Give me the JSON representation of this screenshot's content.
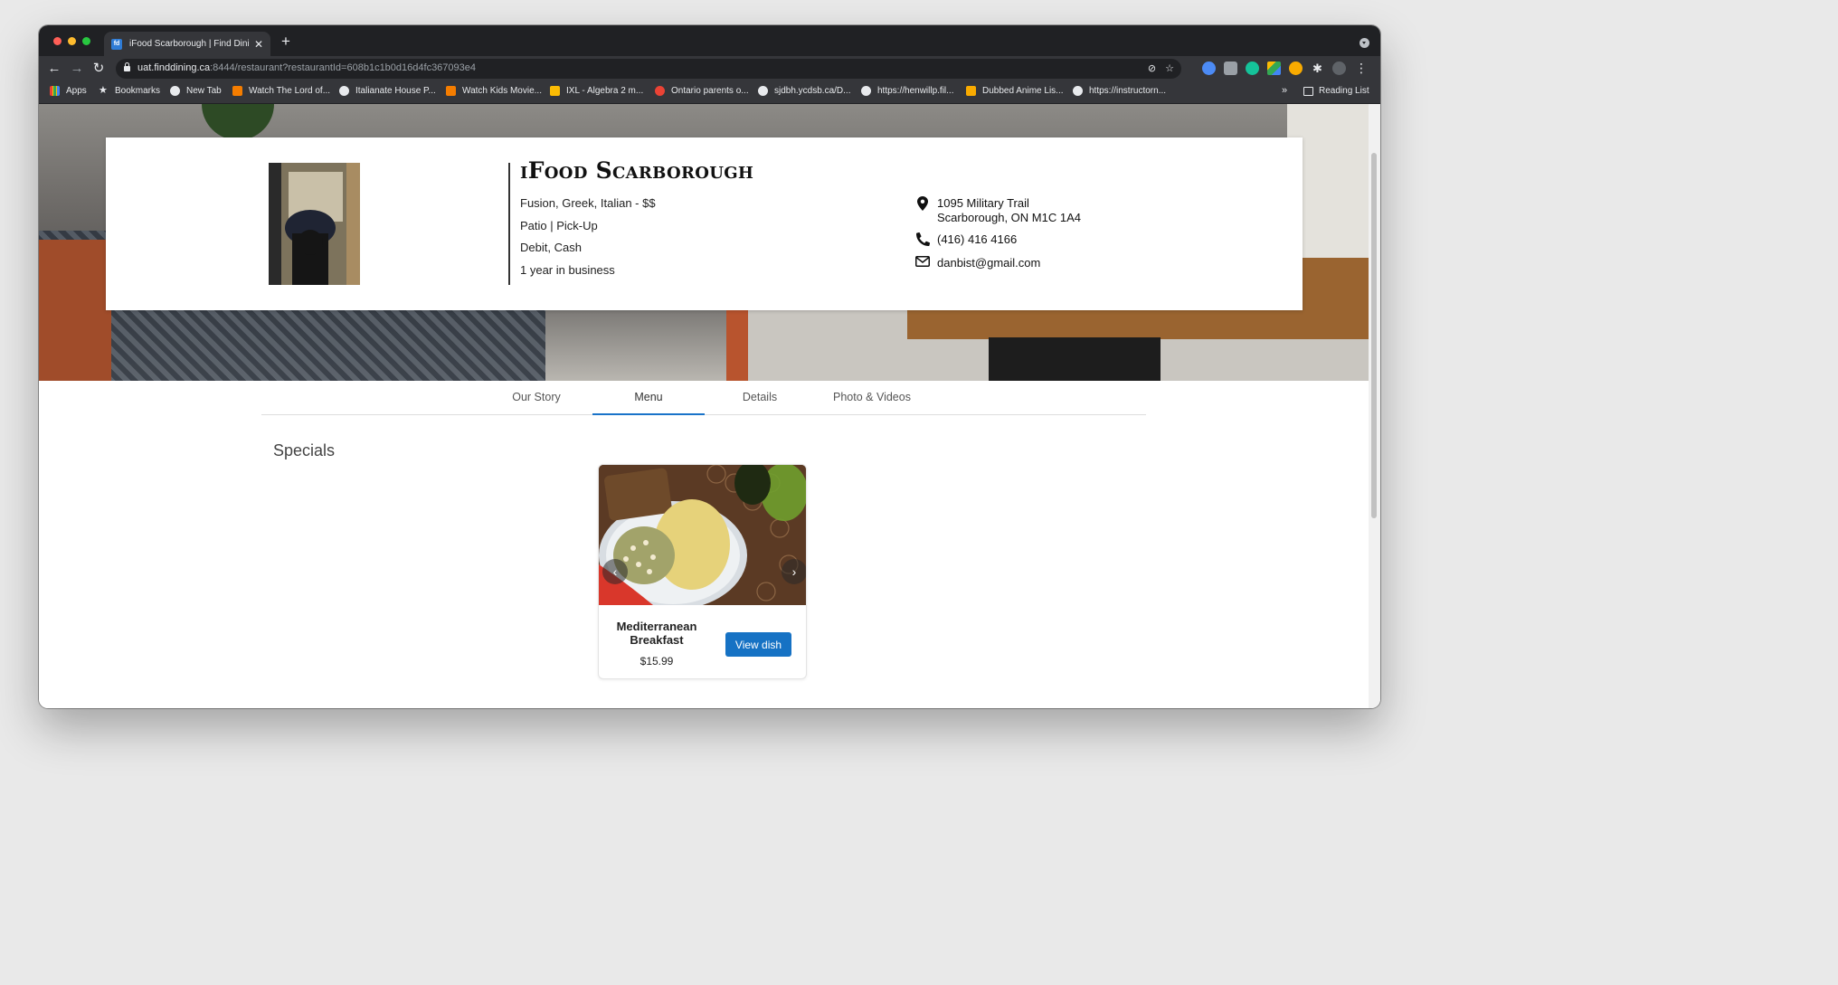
{
  "browser": {
    "tab_title": "iFood Scarborough | Find Dinin",
    "url_host": "uat.finddining.ca",
    "url_rest": ":8444/restaurant?restaurantId=608b1c1b0d16d4fc367093e4",
    "bookmarks": [
      {
        "label": "Apps",
        "icon": "apps-grid-icon"
      },
      {
        "label": "Bookmarks",
        "icon": "star-icon"
      },
      {
        "label": "New Tab",
        "icon": "globe-icon"
      },
      {
        "label": "Watch The Lord of...",
        "icon": "blogger-icon"
      },
      {
        "label": "Italianate House P...",
        "icon": "globe-icon"
      },
      {
        "label": "Watch Kids Movie...",
        "icon": "blogger-icon"
      },
      {
        "label": "IXL - Algebra 2 m...",
        "icon": "ixl-icon"
      },
      {
        "label": "Ontario parents o...",
        "icon": "maple-leaf-icon"
      },
      {
        "label": "sjdbh.ycdsb.ca/D...",
        "icon": "globe-icon"
      },
      {
        "label": "https://henwillp.fil...",
        "icon": "wordpress-icon"
      },
      {
        "label": "Dubbed Anime Lis...",
        "icon": "bookmark-app-icon"
      },
      {
        "label": "https://instructorn...",
        "icon": "globe-icon"
      }
    ],
    "more_label": "»",
    "reading_list": "Reading List"
  },
  "restaurant": {
    "name": "iFood Scarborough",
    "cuisine": "Fusion, Greek, Italian - $$",
    "services": "Patio | Pick-Up",
    "payment": "Debit, Cash",
    "years": "1 year in business",
    "address_line1": "1095 Military Trail",
    "address_line2": "Scarborough, ON M1C 1A4",
    "phone": "(416) 416 4166",
    "email": "danbist@gmail.com"
  },
  "tabs": [
    "Our Story",
    "Menu",
    "Details",
    "Photo & Videos"
  ],
  "active_tab": "Menu",
  "specials": {
    "heading": "Specials",
    "dish": {
      "name": "Mediterranean Breakfast",
      "price": "$15.99",
      "button": "View dish"
    }
  },
  "colors": {
    "accent": "#1672c4",
    "chrome_dark": "#202124",
    "chrome_mid": "#35363a"
  }
}
